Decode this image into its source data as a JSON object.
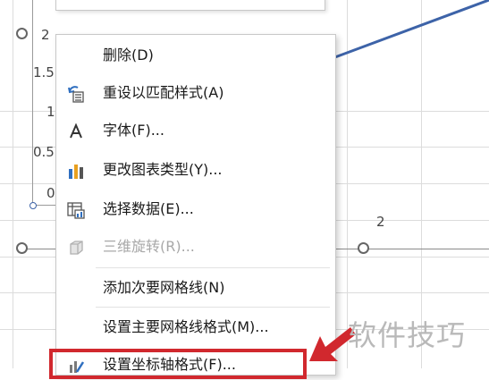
{
  "chart": {
    "y_ticks": [
      "2",
      "1.5",
      "1",
      "0.5",
      "0"
    ],
    "x_ticks": [
      "2"
    ],
    "line_color": "#3d63a8"
  },
  "context_menu": {
    "items": [
      {
        "label": "删除(D)",
        "icon": "none",
        "enabled": true
      },
      {
        "label": "重设以匹配样式(A)",
        "icon": "reset-style-icon",
        "enabled": true
      },
      {
        "label": "字体(F)...",
        "icon": "font-icon",
        "enabled": true
      },
      {
        "label": "更改图表类型(Y)...",
        "icon": "chart-type-icon",
        "enabled": true
      },
      {
        "label": "选择数据(E)...",
        "icon": "select-data-icon",
        "enabled": true
      },
      {
        "label": "三维旋转(R)...",
        "icon": "3d-rotation-icon",
        "enabled": false
      },
      {
        "label": "添加次要网格线(N)",
        "icon": "none",
        "enabled": true
      },
      {
        "label": "设置主要网格线格式(M)...",
        "icon": "none",
        "enabled": true
      },
      {
        "label": "设置坐标轴格式(F)...",
        "icon": "format-axis-icon",
        "enabled": true
      }
    ]
  },
  "highlight_color": "#d1282e",
  "watermark": "软件技巧"
}
